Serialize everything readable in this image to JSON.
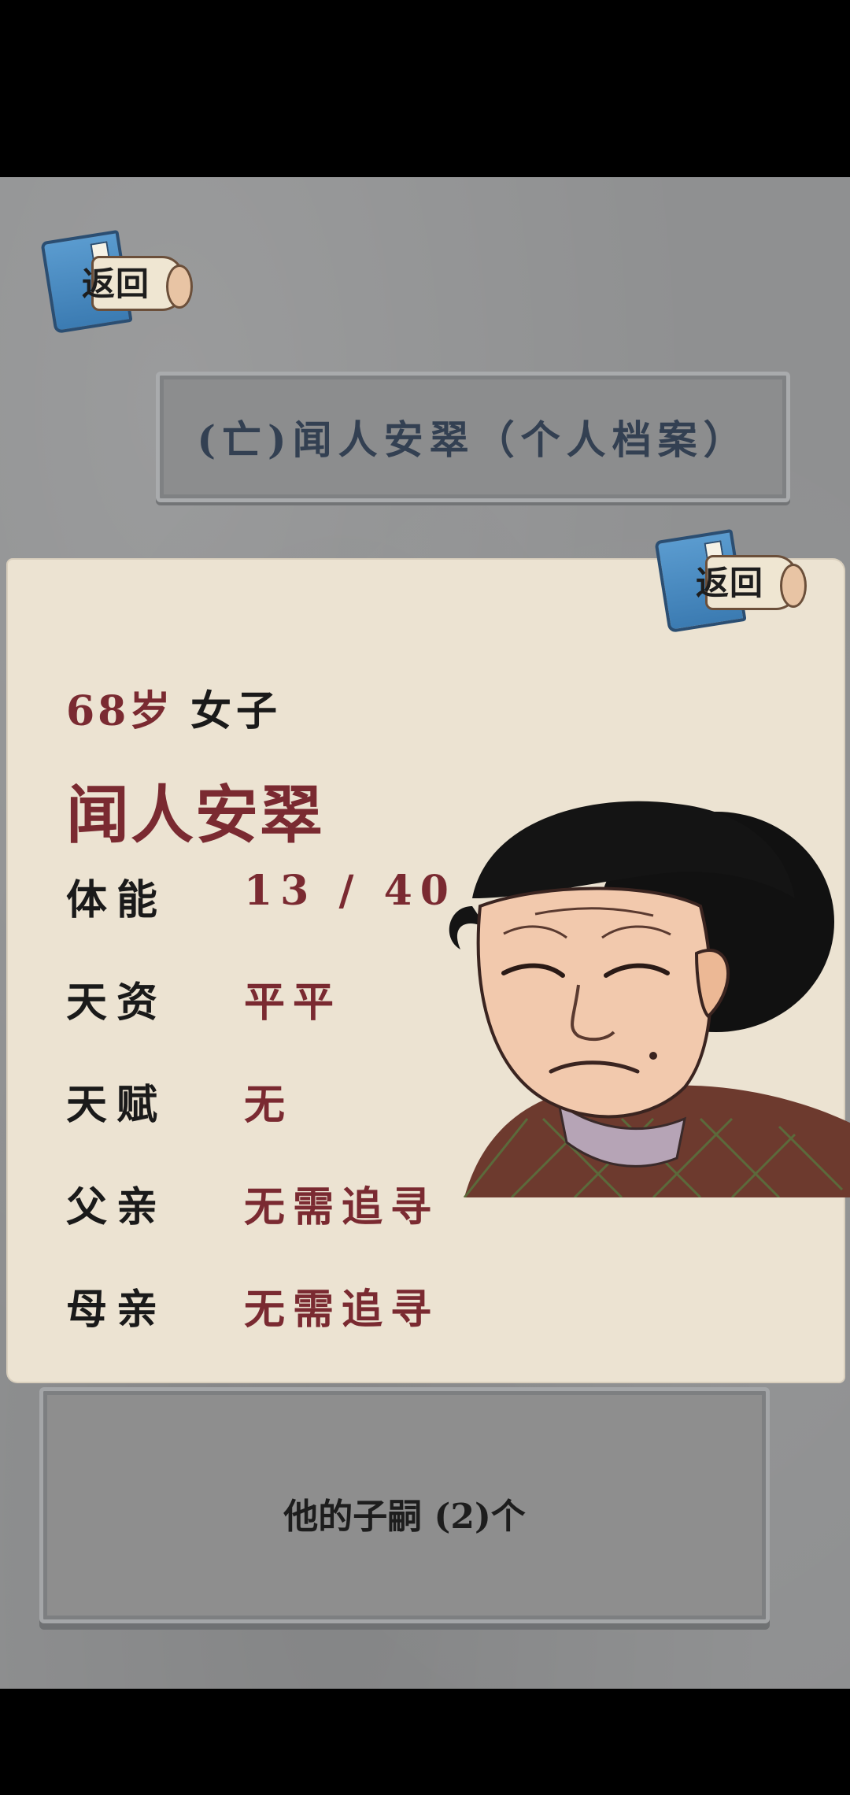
{
  "header": {
    "back_label": "返回",
    "title": "(亡)闻人安翠（个人档案）"
  },
  "card": {
    "back_label": "返回",
    "age": "68岁",
    "sex": "女子",
    "name": "闻人安翠",
    "stats": [
      {
        "label": "体能",
        "value": "13 / 40"
      },
      {
        "label": "天资",
        "value": "平平"
      },
      {
        "label": "天赋",
        "value": "无"
      },
      {
        "label": "父亲",
        "value": "无需追寻"
      },
      {
        "label": "母亲",
        "value": "无需追寻"
      }
    ]
  },
  "children": {
    "label": "他的子嗣 (2)个"
  },
  "colors": {
    "accent": "#7a2a31",
    "parchment": "#ece3d2",
    "title_text": "#334052"
  }
}
